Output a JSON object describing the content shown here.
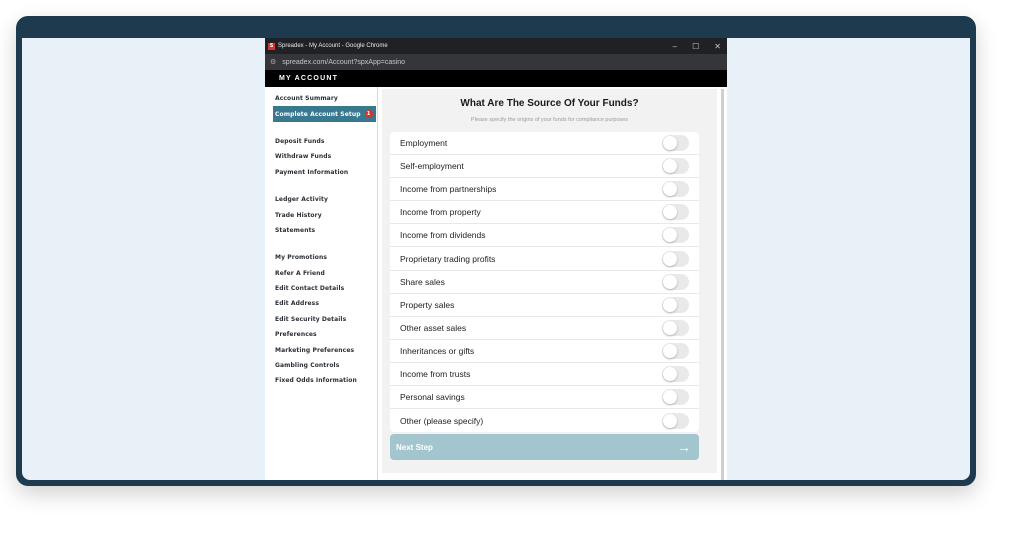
{
  "window": {
    "title": "Spreadex - My Account - Google Chrome",
    "logo_letter": "S",
    "url": "spreadex.com/Account?spxApp=casino",
    "controls": [
      "–",
      "☐",
      "✕"
    ]
  },
  "header": {
    "title": "MY ACCOUNT"
  },
  "sidebar": {
    "groups": [
      [
        {
          "label": "Account Summary"
        },
        {
          "label": "Complete Account Setup",
          "badge": "1",
          "active": true
        }
      ],
      [
        {
          "label": "Deposit Funds"
        },
        {
          "label": "Withdraw Funds"
        },
        {
          "label": "Payment Information"
        }
      ],
      [
        {
          "label": "Ledger Activity"
        },
        {
          "label": "Trade History"
        },
        {
          "label": "Statements"
        }
      ],
      [
        {
          "label": "My Promotions"
        },
        {
          "label": "Refer A Friend"
        },
        {
          "label": "Edit Contact Details"
        },
        {
          "label": "Edit Address"
        },
        {
          "label": "Edit Security Details"
        },
        {
          "label": "Preferences"
        },
        {
          "label": "Marketing Preferences"
        },
        {
          "label": "Gambling Controls"
        },
        {
          "label": "Fixed Odds Information"
        }
      ]
    ]
  },
  "main": {
    "title": "What Are The Source Of Your Funds?",
    "subtitle": "Please specify the origins of your funds for compliance purposes",
    "options": [
      {
        "label": "Employment",
        "on": false
      },
      {
        "label": "Self-employment",
        "on": false
      },
      {
        "label": "Income from partnerships",
        "on": false
      },
      {
        "label": "Income from property",
        "on": false
      },
      {
        "label": "Income from dividends",
        "on": false
      },
      {
        "label": "Proprietary trading profits",
        "on": false
      },
      {
        "label": "Share sales",
        "on": false
      },
      {
        "label": "Property sales",
        "on": false
      },
      {
        "label": "Other asset sales",
        "on": false
      },
      {
        "label": "Inheritances or gifts",
        "on": false
      },
      {
        "label": "Income from trusts",
        "on": false
      },
      {
        "label": "Personal savings",
        "on": false
      },
      {
        "label": "Other (please specify)",
        "on": false
      }
    ],
    "next_label": "Next Step",
    "next_icon": "arrow-right-icon"
  },
  "colors": {
    "frame": "#1d3a4f",
    "active_item": "#38798f",
    "button": "#a3c5cd",
    "badge": "#d9342b"
  }
}
